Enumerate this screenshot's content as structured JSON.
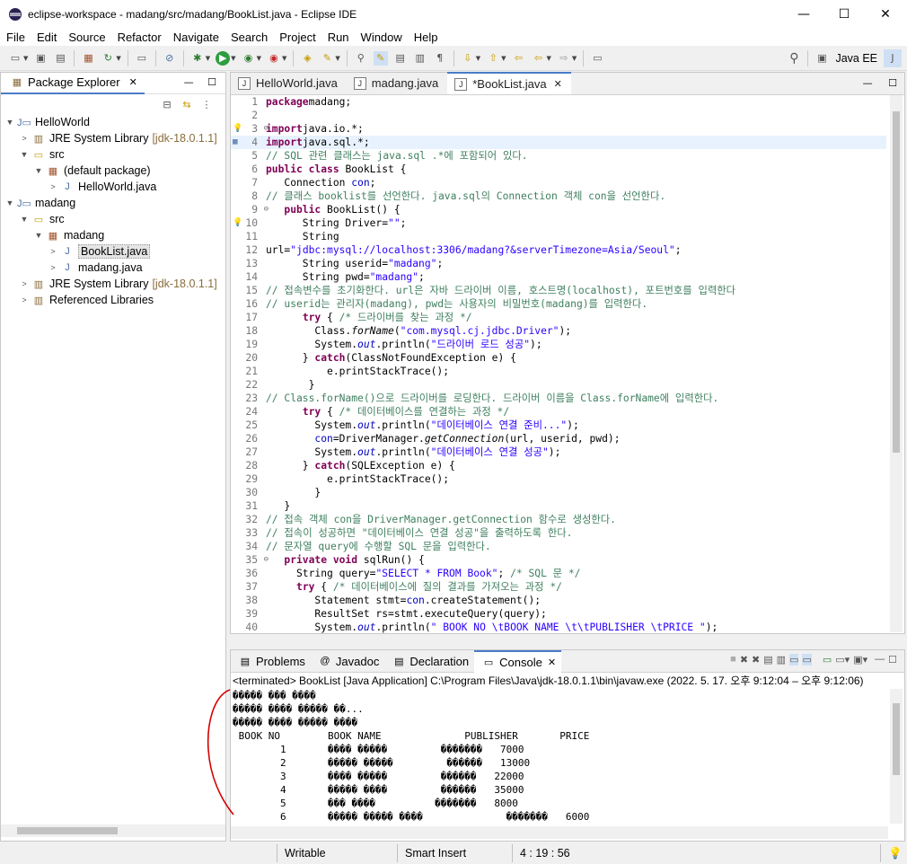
{
  "window": {
    "title": "eclipse-workspace - madang/src/madang/BookList.java - Eclipse IDE",
    "minimize": "—",
    "maximize": "☐",
    "close": "✕"
  },
  "menu": [
    "File",
    "Edit",
    "Source",
    "Refactor",
    "Navigate",
    "Search",
    "Project",
    "Run",
    "Window",
    "Help"
  ],
  "perspective": {
    "label": "Java EE"
  },
  "package_explorer": {
    "title": "Package Explorer",
    "close": "✕",
    "minimize": "—",
    "maximize": "☐",
    "tree": [
      {
        "label": "HelloWorld",
        "depth": 0,
        "twisty": "▼",
        "icon": "java-project-icon"
      },
      {
        "label": "JRE System Library",
        "deco": "[jdk-18.0.1.1]",
        "depth": 1,
        "twisty": ">",
        "icon": "library-icon"
      },
      {
        "label": "src",
        "depth": 1,
        "twisty": "▼",
        "icon": "source-folder-icon"
      },
      {
        "label": "(default package)",
        "depth": 2,
        "twisty": "▼",
        "icon": "package-icon"
      },
      {
        "label": "HelloWorld.java",
        "depth": 3,
        "twisty": ">",
        "icon": "java-file-icon"
      },
      {
        "label": "madang",
        "depth": 0,
        "twisty": "▼",
        "icon": "java-project-icon"
      },
      {
        "label": "src",
        "depth": 1,
        "twisty": "▼",
        "icon": "source-folder-icon"
      },
      {
        "label": "madang",
        "depth": 2,
        "twisty": "▼",
        "icon": "package-icon"
      },
      {
        "label": "BookList.java",
        "depth": 3,
        "twisty": ">",
        "icon": "java-file-icon",
        "selected": true
      },
      {
        "label": "madang.java",
        "depth": 3,
        "twisty": ">",
        "icon": "java-file-icon"
      },
      {
        "label": "JRE System Library",
        "deco": "[jdk-18.0.1.1]",
        "depth": 1,
        "twisty": ">",
        "icon": "library-icon"
      },
      {
        "label": "Referenced Libraries",
        "depth": 1,
        "twisty": ">",
        "icon": "library-icon"
      }
    ]
  },
  "editor": {
    "tabs": [
      {
        "label": "HelloWorld.java",
        "active": false
      },
      {
        "label": "madang.java",
        "active": false
      },
      {
        "label": "*BookList.java",
        "active": true
      }
    ],
    "lines": [
      {
        "n": "1",
        "t": [
          [
            "kw",
            "package"
          ],
          [
            "",
            "madang;"
          ]
        ]
      },
      {
        "n": "2",
        "t": []
      },
      {
        "n": "3",
        "mk": "warn",
        "fold": "⊖",
        "t": [
          [
            "kw",
            "import"
          ],
          [
            "",
            "java.io.*;"
          ]
        ]
      },
      {
        "n": "4",
        "mk": "dot",
        "t": [
          [
            "kw",
            "import"
          ],
          [
            "",
            "java.sql.*;"
          ]
        ],
        "cur": true
      },
      {
        "n": "5",
        "t": [
          [
            "cm",
            "// SQL 관련 클래스는 java.sql .*에 포함되어 있다."
          ]
        ]
      },
      {
        "n": "6",
        "t": [
          [
            "kw",
            "public"
          ],
          [
            "",
            " "
          ],
          [
            "kw",
            "class"
          ],
          [
            "",
            " BookList {"
          ]
        ]
      },
      {
        "n": "7",
        "t": [
          [
            "",
            "   Connection "
          ],
          [
            "fld",
            "con"
          ],
          [
            "",
            ";"
          ]
        ]
      },
      {
        "n": "8",
        "t": [
          [
            "cm",
            "// 클래스 booklist를 선언한다. java.sql의 Connection 객체 con을 선언한다."
          ]
        ]
      },
      {
        "n": "9",
        "fold": "⊖",
        "t": [
          [
            "",
            "   "
          ],
          [
            "kw",
            "public"
          ],
          [
            "",
            " BookList() {"
          ]
        ]
      },
      {
        "n": "10",
        "mk": "warn",
        "t": [
          [
            "",
            "      String Driver="
          ],
          [
            "str",
            "\"\""
          ],
          [
            "",
            ";"
          ]
        ]
      },
      {
        "n": "11",
        "t": [
          [
            "",
            "      String"
          ]
        ]
      },
      {
        "n": "12",
        "t": [
          [
            "",
            "url="
          ],
          [
            "str",
            "\"jdbc:mysql://localhost:3306/madang?&serverTimezone=Asia/Seoul\""
          ],
          [
            "",
            ";"
          ]
        ]
      },
      {
        "n": "13",
        "t": [
          [
            "",
            "      String userid="
          ],
          [
            "str",
            "\"madang\""
          ],
          [
            "",
            ";"
          ]
        ]
      },
      {
        "n": "14",
        "t": [
          [
            "",
            "      String pwd="
          ],
          [
            "str",
            "\"madang\""
          ],
          [
            "",
            ";"
          ]
        ]
      },
      {
        "n": "15",
        "t": [
          [
            "cm",
            "// 접속변수를 초기화한다. url은 자바 드라이버 이름, 호스트명(localhost), 포트번호를 입력한다"
          ]
        ]
      },
      {
        "n": "16",
        "t": [
          [
            "cm",
            "// userid는 관리자(madang), pwd는 사용자의 비밀번호(madang)를 입력한다."
          ]
        ]
      },
      {
        "n": "17",
        "t": [
          [
            "",
            "      "
          ],
          [
            "kw",
            "try"
          ],
          [
            "",
            " { "
          ],
          [
            "cm",
            "/* 드라이버를 찾는 과정 */"
          ]
        ]
      },
      {
        "n": "18",
        "t": [
          [
            "",
            "        Class."
          ],
          [
            "it",
            "forName"
          ],
          [
            "",
            "("
          ],
          [
            "str",
            "\"com.mysql.cj.jdbc.Driver\""
          ],
          [
            "",
            ");"
          ]
        ]
      },
      {
        "n": "19",
        "t": [
          [
            "",
            "        System."
          ],
          [
            "fld it",
            "out"
          ],
          [
            "",
            ".println("
          ],
          [
            "str",
            "\"드라이버 로드 성공\""
          ],
          [
            "",
            ");"
          ]
        ]
      },
      {
        "n": "20",
        "t": [
          [
            "",
            "      } "
          ],
          [
            "kw",
            "catch"
          ],
          [
            "",
            "(ClassNotFoundException e) {"
          ]
        ]
      },
      {
        "n": "21",
        "t": [
          [
            "",
            "          e.printStackTrace();"
          ]
        ]
      },
      {
        "n": "22",
        "t": [
          [
            "",
            "       }"
          ]
        ]
      },
      {
        "n": "23",
        "t": [
          [
            "cm",
            "// Class.forName()으로 드라이버를 로딩한다. 드라이버 이름을 Class.forName에 입력한다."
          ]
        ]
      },
      {
        "n": "24",
        "t": [
          [
            "",
            "      "
          ],
          [
            "kw",
            "try"
          ],
          [
            "",
            " { "
          ],
          [
            "cm",
            "/* 데이터베이스를 연결하는 과정 */"
          ]
        ]
      },
      {
        "n": "25",
        "t": [
          [
            "",
            "        System."
          ],
          [
            "fld it",
            "out"
          ],
          [
            "",
            ".println("
          ],
          [
            "str",
            "\"데이터베이스 연결 준비...\""
          ],
          [
            "",
            ");"
          ]
        ]
      },
      {
        "n": "26",
        "t": [
          [
            "",
            "        "
          ],
          [
            "fld",
            "con"
          ],
          [
            "",
            "=DriverManager."
          ],
          [
            "it",
            "getConnection"
          ],
          [
            "",
            "(url, userid, pwd);"
          ]
        ]
      },
      {
        "n": "27",
        "t": [
          [
            "",
            "        System."
          ],
          [
            "fld it",
            "out"
          ],
          [
            "",
            ".println("
          ],
          [
            "str",
            "\"데이터베이스 연결 성공\""
          ],
          [
            "",
            ");"
          ]
        ]
      },
      {
        "n": "28",
        "t": [
          [
            "",
            "      } "
          ],
          [
            "kw",
            "catch"
          ],
          [
            "",
            "(SQLException e) {"
          ]
        ]
      },
      {
        "n": "29",
        "t": [
          [
            "",
            "          e.printStackTrace();"
          ]
        ]
      },
      {
        "n": "30",
        "t": [
          [
            "",
            "        }"
          ]
        ]
      },
      {
        "n": "31",
        "t": [
          [
            "",
            "   }"
          ]
        ]
      },
      {
        "n": "32",
        "t": [
          [
            "cm",
            "// 접속 객체 con을 DriverManager.getConnection 함수로 생성한다."
          ]
        ]
      },
      {
        "n": "33",
        "t": [
          [
            "cm",
            "// 접속이 성공하면 \"데이터베이스 연결 성공\"을 출력하도록 한다."
          ]
        ]
      },
      {
        "n": "34",
        "t": [
          [
            "cm",
            "// 문자열 query에 수행할 SQL 문을 입력한다."
          ]
        ]
      },
      {
        "n": "35",
        "fold": "⊖",
        "t": [
          [
            "",
            "   "
          ],
          [
            "kw",
            "private"
          ],
          [
            "",
            " "
          ],
          [
            "kw",
            "void"
          ],
          [
            "",
            " sqlRun() {"
          ]
        ]
      },
      {
        "n": "36",
        "t": [
          [
            "",
            "     String query="
          ],
          [
            "str",
            "\"SELECT * FROM Book\""
          ],
          [
            "",
            "; "
          ],
          [
            "cm",
            "/* SQL 문 */"
          ]
        ]
      },
      {
        "n": "37",
        "t": [
          [
            "",
            "     "
          ],
          [
            "kw",
            "try"
          ],
          [
            "",
            " { "
          ],
          [
            "cm",
            "/* 데이터베이스에 질의 결과를 가져오는 과정 */"
          ]
        ]
      },
      {
        "n": "38",
        "t": [
          [
            "",
            "        Statement stmt="
          ],
          [
            "fld",
            "con"
          ],
          [
            "",
            ".createStatement();"
          ]
        ]
      },
      {
        "n": "39",
        "t": [
          [
            "",
            "        ResultSet rs=stmt.executeQuery(query);"
          ]
        ]
      },
      {
        "n": "40",
        "t": [
          [
            "",
            "        System."
          ],
          [
            "fld it",
            "out"
          ],
          [
            "",
            ".println("
          ],
          [
            "str",
            "\" BOOK NO \\tBOOK NAME \\t\\tPUBLISHER \\tPRICE \""
          ],
          [
            "",
            ");"
          ]
        ]
      }
    ]
  },
  "console": {
    "tabs": [
      {
        "label": "Problems",
        "icon": "problems-icon"
      },
      {
        "label": "Javadoc",
        "icon": "at-icon"
      },
      {
        "label": "Declaration",
        "icon": "declaration-icon"
      },
      {
        "label": "Console",
        "icon": "console-icon",
        "active": true
      }
    ],
    "status": "<terminated> BookList [Java Application] C:\\Program Files\\Java\\jdk-18.0.1.1\\bin\\javaw.exe  (2022. 5. 17. 오후 9:12:04 – 오후 9:12:06)",
    "lines": [
      "����� ��� ����",
      "����� ���� ����� ��...",
      "����� ���� ����� ����",
      " BOOK NO        BOOK NAME              PUBLISHER       PRICE ",
      "        1       ���� �����         �������   7000",
      "        2       ����� �����         ������   13000",
      "        3       ���� �����         ������   22000",
      "        4       ����� ����         ������   35000",
      "        5       ��� ����          �������   8000",
      "        6       ����� ����� ����              �������   6000"
    ]
  },
  "statusbar": {
    "mode": "Writable",
    "insert": "Smart Insert",
    "position": "4 : 19 : 56"
  }
}
